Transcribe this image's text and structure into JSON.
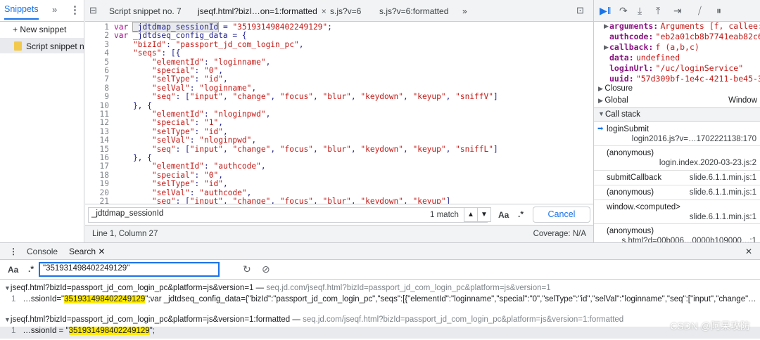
{
  "left_panel": {
    "tab": "Snippets",
    "new_snippet": "+ New snippet",
    "snippet_item": "Script snippet no. 7"
  },
  "editor_tabs": [
    {
      "label": "Script snippet no. 7"
    },
    {
      "label": "jseqf.html?bizI…on=1:formatted",
      "close": "×"
    },
    {
      "label": "s.js?v=6"
    },
    {
      "label": "s.js?v=6:formatted"
    },
    {
      "label": "»"
    }
  ],
  "code": {
    "lines": [
      {
        "n": "1",
        "t": "var _jdtdmap_sessionId = \"351931498402249129\";"
      },
      {
        "n": "2",
        "t": "var _jdtdseq_config_data = {"
      },
      {
        "n": "3",
        "t": "    \"bizId\": \"passport_jd_com_login_pc\","
      },
      {
        "n": "4",
        "t": "    \"seqs\": [{"
      },
      {
        "n": "5",
        "t": "        \"elementId\": \"loginname\","
      },
      {
        "n": "6",
        "t": "        \"special\": \"0\","
      },
      {
        "n": "7",
        "t": "        \"selType\": \"id\","
      },
      {
        "n": "8",
        "t": "        \"selVal\": \"loginname\","
      },
      {
        "n": "9",
        "t": "        \"seq\": [\"input\", \"change\", \"focus\", \"blur\", \"keydown\", \"keyup\", \"sniffV\"]"
      },
      {
        "n": "10",
        "t": "    }, {"
      },
      {
        "n": "11",
        "t": "        \"elementId\": \"nloginpwd\","
      },
      {
        "n": "12",
        "t": "        \"special\": \"1\","
      },
      {
        "n": "13",
        "t": "        \"selType\": \"id\","
      },
      {
        "n": "14",
        "t": "        \"selVal\": \"nloginpwd\","
      },
      {
        "n": "15",
        "t": "        \"seq\": [\"input\", \"change\", \"focus\", \"blur\", \"keydown\", \"keyup\", \"sniffL\"]"
      },
      {
        "n": "16",
        "t": "    }, {"
      },
      {
        "n": "17",
        "t": "        \"elementId\": \"authcode\","
      },
      {
        "n": "18",
        "t": "        \"special\": \"0\","
      },
      {
        "n": "19",
        "t": "        \"selType\": \"id\","
      },
      {
        "n": "20",
        "t": "        \"selVal\": \"authcode\","
      },
      {
        "n": "21",
        "t": "        \"seq\": [\"input\", \"change\", \"focus\", \"blur\", \"keydown\", \"keyup\"]"
      }
    ]
  },
  "find_bar": {
    "query": "_jdtdmap_sessionId",
    "match_count": "1 match",
    "up": "▲",
    "down": "▼",
    "case": "Aa",
    "regex": ".*",
    "cancel": "Cancel"
  },
  "status_bar": {
    "position": "Line 1, Column 27",
    "coverage": "Coverage: N/A"
  },
  "scope": {
    "props": [
      {
        "key": "arguments:",
        "value": "Arguments [f, callee: f"
      },
      {
        "key": "authcode:",
        "value": "\"eb2a01cb8b7741eab82c6"
      },
      {
        "key": "callback:",
        "value": "f (a,b,c)"
      },
      {
        "key": "data:",
        "value": "undefined"
      },
      {
        "key": "loginUrl:",
        "value": "\"/uc/loginService\""
      },
      {
        "key": "uuid:",
        "value": "\"57d309bf-1e4c-4211-be45-3"
      }
    ],
    "closure": "Closure",
    "global": "Global",
    "global_value": "Window"
  },
  "call_stack": {
    "title": "Call stack",
    "frames": [
      {
        "fn": "loginSubmit",
        "loc": "login2016.js?v=…1702221138:170"
      },
      {
        "fn": "(anonymous)",
        "loc": "login.index.2020-03-23.js:2"
      },
      {
        "fn": "submitCallback",
        "loc": "slide.6.1.1.min.js:1"
      },
      {
        "fn": "(anonymous)",
        "loc": "slide.6.1.1.min.js:1"
      },
      {
        "fn": "window.<computed>",
        "loc": "slide.6.1.1.min.js:1"
      },
      {
        "fn": "(anonymous)",
        "loc": "s.html?d=00b006…0000b109000…:1"
      }
    ]
  },
  "drawer": {
    "tabs": [
      "Console",
      "Search"
    ],
    "search_query": "\"351931498402249129\"",
    "case": "Aa",
    "regex": ".*",
    "results": [
      {
        "file": "jseqf.html?bizId=passport_jd_com_login_pc&platform=js&version=1",
        "url": "seq.jd.com/jseqf.html?bizId=passport_jd_com_login_pc&platform=js&version=1",
        "line": "1",
        "pre": "…ssionId=\"",
        "match": "351931498402249129",
        "post": "\";var _jdtdseq_config_data={\"bizId\":\"passport_jd_com_login_pc\",\"seqs\":[{\"elementId\":\"loginname\",\"special\":\"0\",\"selType\":\"id\",\"selVal\":\"loginname\",\"seq\":[\"input\",\"change\"…"
      },
      {
        "file": "jseqf.html?bizId=passport_jd_com_login_pc&platform=js&version=1:formatted",
        "url": "seq.jd.com/jseqf.html?bizId=passport_jd_com_login_pc&platform=js&version=1:formatted",
        "line": "1",
        "pre": "…ssionId = \"",
        "match": "351931498402249129",
        "post": "\";"
      }
    ]
  },
  "watermark": "CSDN @阿呆攻防",
  "colors": {
    "accent": "#1a73e8",
    "match": "#ffea00"
  }
}
